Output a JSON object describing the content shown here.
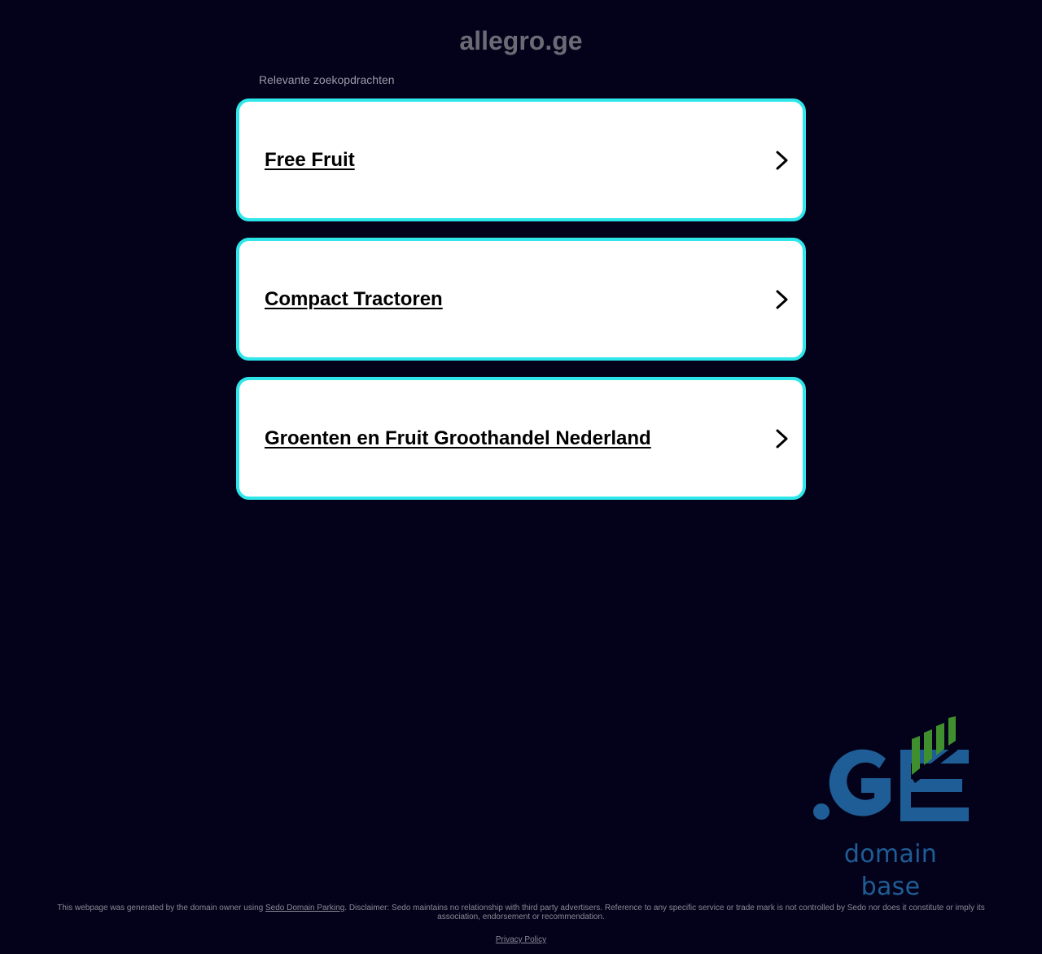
{
  "header": {
    "domain": "allegro.ge"
  },
  "related": {
    "label": "Relevante zoekopdrachten",
    "items": [
      {
        "label": "Free Fruit"
      },
      {
        "label": "Compact Tractoren"
      },
      {
        "label": "Groenten en Fruit Groothandel Nederland"
      }
    ]
  },
  "logo": {
    "mark": ".GE",
    "caption": "domain base",
    "colors": {
      "blue": "#1f5d96",
      "green": "#3f8f2e"
    }
  },
  "footer": {
    "prefix": "This webpage was generated by the domain owner using ",
    "sedo_link": "Sedo Domain Parking",
    "disclaimer": ". Disclaimer: Sedo maintains no relationship with third party advertisers. Reference to any specific service or trade mark is not controlled by Sedo nor does it constitute or imply its association, endorsement or recommendation.",
    "privacy_link": "Privacy Policy"
  },
  "colors": {
    "background": "#03021a",
    "card_border": "#2fe6ea",
    "card_background": "#ffffff"
  }
}
